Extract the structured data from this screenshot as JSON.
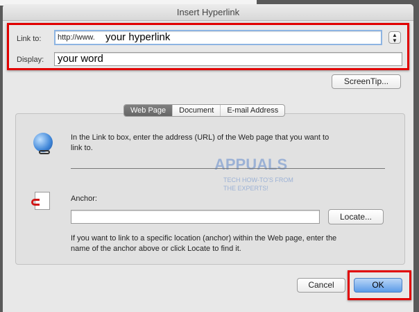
{
  "dialog": {
    "title": "Insert Hyperlink"
  },
  "link": {
    "label": "Link to:",
    "prefix": "http://www.",
    "value": "your hyperlink"
  },
  "display": {
    "label": "Display:",
    "value": "your word"
  },
  "buttons": {
    "screentip": "ScreenTip...",
    "locate": "Locate...",
    "cancel": "Cancel",
    "ok": "OK"
  },
  "tabs": [
    {
      "label": "Web Page",
      "active": true
    },
    {
      "label": "Document"
    },
    {
      "label": "E-mail Address"
    }
  ],
  "web_page": {
    "instruction": "In the Link to box, enter the address (URL) of the Web page that you want to link to.",
    "anchor_label": "Anchor:",
    "anchor_value": "",
    "anchor_help": "If you want to link to a specific location (anchor) within the Web page, enter the name of the anchor above or click Locate to find it."
  },
  "watermark": {
    "brand": "APPUALS",
    "tagline": "TECH HOW-TO'S FROM THE EXPERTS!"
  },
  "colors": {
    "highlight": "#e10000",
    "ok_button": "#5b9be8"
  }
}
